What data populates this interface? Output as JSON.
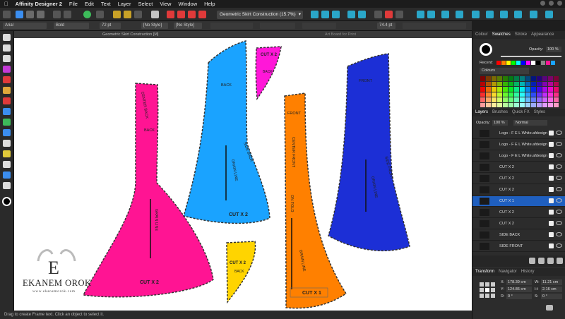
{
  "menubar": {
    "app_name": "Affinity Designer 2",
    "items": [
      "File",
      "Edit",
      "Text",
      "Layer",
      "Select",
      "View",
      "Window",
      "Help"
    ]
  },
  "toolbar": {
    "document_title": "Geometric Skirt Construction (15.7%)"
  },
  "contextbar": {
    "font": "Arial",
    "weight": "Bold",
    "size": "72 pt",
    "style1": "[No Style]",
    "style2": "[No Style]",
    "tracking": "74.4 pt"
  },
  "canvas": {
    "tab1": "Geometric Skirt Construction [M]",
    "tab2": "Art Board for Print",
    "pieces": {
      "pink": {
        "top_label": "CENTER BACK",
        "mid_label": "BACK",
        "grain_label": "GRAIN LINE",
        "cut": "CUT X 2",
        "color": "#ff1493"
      },
      "lightblue": {
        "top_label": "BACK",
        "side_label": "SIDE BACK",
        "grain_label": "GRAIN LINE",
        "cut": "CUT X 2",
        "color": "#1aa3ff"
      },
      "magenta": {
        "top_label": "CUT X 2",
        "sub_label": "BACK",
        "color": "#ff17d8"
      },
      "yellow": {
        "cut": "CUT X 2",
        "sub_label": "BACK",
        "color": "#ffd400"
      },
      "orange": {
        "top_label": "FRONT",
        "side_label": "CENTER FRONT",
        "fold_label": "ON FOLD",
        "grain_label": "GRAIN LINE",
        "cut": "CUT X 1",
        "color": "#ff8000"
      },
      "darkblue": {
        "top_label": "FRONT",
        "side_label": "SIDE FRONT",
        "grain_label": "GRAIN LINE",
        "color": "#1c2fd6"
      }
    },
    "logo": {
      "monogram": "E",
      "name": "EKANEM OROK",
      "url": "www.ekanemorok.com"
    }
  },
  "statusbar": {
    "text": "Drag to create Frame text. Click an object to select it."
  },
  "colour_panel": {
    "tabs": [
      "Colour",
      "Swatches",
      "Stroke",
      "Appearance"
    ],
    "active_tab": "Swatches",
    "opacity_label": "Opacity:",
    "opacity_value": "100 %",
    "recent_label": "Recent:",
    "palette_name": "Colours",
    "recent_colors": [
      "#ff0000",
      "#ff8000",
      "#ffff00",
      "#00ff00",
      "#00ffff",
      "#0000ff",
      "#ff00ff",
      "#ffffff",
      "#000000",
      "#888888",
      "#ff1493",
      "#1aa3ff"
    ]
  },
  "layers_panel": {
    "tabs": [
      "Layers",
      "Brushes",
      "Quick FX",
      "Styles"
    ],
    "active_tab": "Layers",
    "opacity_label": "Opacity:",
    "opacity_value": "100 %",
    "blend_mode": "Normal",
    "rows": [
      {
        "name": "Logo - F E L White.afdesign",
        "selected": false
      },
      {
        "name": "Logo - F E L White.afdesign",
        "selected": false
      },
      {
        "name": "Logo - F E L White.afdesign",
        "selected": false
      },
      {
        "name": "CUT X 2",
        "selected": false
      },
      {
        "name": "CUT X 2",
        "selected": false
      },
      {
        "name": "CUT X 2",
        "selected": false
      },
      {
        "name": "CUT X 1",
        "selected": true
      },
      {
        "name": "CUT X 2",
        "selected": false
      },
      {
        "name": "CUT X 2",
        "selected": false
      },
      {
        "name": "SIDE BACK",
        "selected": false
      },
      {
        "name": "SIDE FRONT",
        "selected": false
      }
    ]
  },
  "transform_panel": {
    "tabs": [
      "Transform",
      "Navigator",
      "History"
    ],
    "active_tab": "Transform",
    "x_label": "X:",
    "x_value": "178.39 cm",
    "y_label": "Y:",
    "y_value": "124.86 cm",
    "w_label": "W:",
    "w_value": "11.21 cm",
    "h_label": "H:",
    "h_value": "2.16 cm",
    "r_label": "R:",
    "r_value": "0 °",
    "s_label": "S:",
    "s_value": "0 °"
  }
}
